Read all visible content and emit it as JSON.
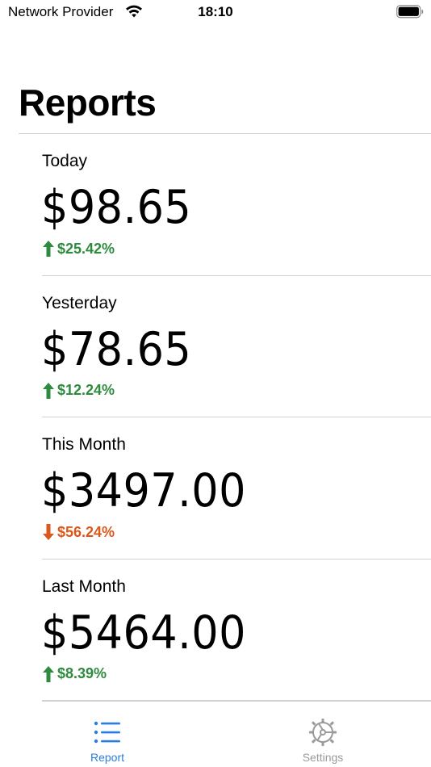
{
  "status_bar": {
    "carrier": "Network Provider",
    "time": "18:10"
  },
  "page": {
    "title": "Reports"
  },
  "reports": [
    {
      "label": "Today",
      "amount": "$98.65",
      "change": "$25.42%",
      "direction": "up"
    },
    {
      "label": "Yesterday",
      "amount": "$78.65",
      "change": "$12.24%",
      "direction": "up"
    },
    {
      "label": "This Month",
      "amount": "$3497.00",
      "change": "$56.24%",
      "direction": "down"
    },
    {
      "label": "Last Month",
      "amount": "$5464.00",
      "change": "$8.39%",
      "direction": "up"
    }
  ],
  "tab_bar": {
    "report_label": "Report",
    "settings_label": "Settings",
    "selected": "Report"
  },
  "colors": {
    "up": "#2e8b3e",
    "down": "#d9581a",
    "accent": "#2a7de1",
    "inactive": "#9a9a9a"
  },
  "icons": {
    "wifi": "wifi-icon",
    "battery": "battery-icon",
    "report_tab": "list-icon",
    "settings_tab": "gear-icon",
    "up": "arrow-up-icon",
    "down": "arrow-down-icon"
  }
}
